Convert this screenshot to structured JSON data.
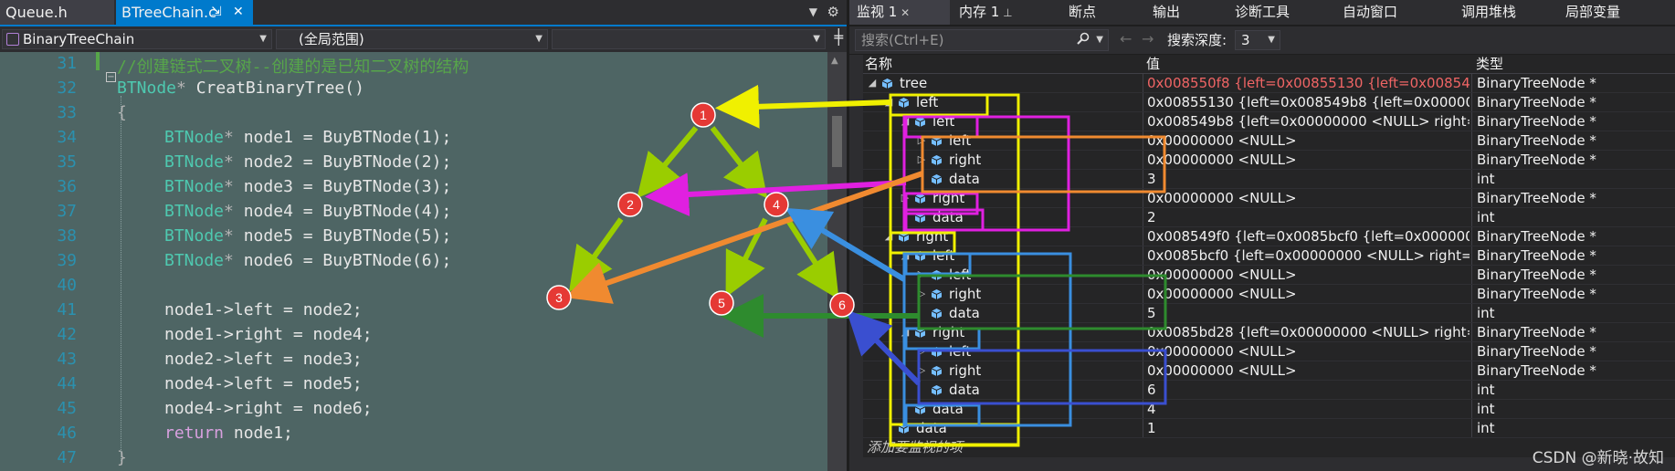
{
  "editor": {
    "tabs": [
      {
        "label": "Queue.h"
      },
      {
        "label": "BTreeChain.c"
      }
    ],
    "nav": {
      "file_scope": "BinaryTreeChain",
      "global_scope": "(全局范围)",
      "member": ""
    },
    "lines": [
      {
        "n": "31",
        "tokens": [
          {
            "c": "comment",
            "t": "//创建链式二叉树--创建的是已知二叉树的结构"
          }
        ]
      },
      {
        "n": "32",
        "tokens": [
          {
            "c": "type",
            "t": "BTNode"
          },
          {
            "c": "punct",
            "t": "* "
          },
          {
            "c": "plain",
            "t": "CreatBinaryTree()"
          }
        ]
      },
      {
        "n": "33",
        "tokens": [
          {
            "c": "punct",
            "t": "{"
          }
        ]
      },
      {
        "n": "34",
        "tokens": [
          {
            "c": "type",
            "t": "BTNode"
          },
          {
            "c": "punct",
            "t": "* "
          },
          {
            "c": "plain",
            "t": "node1 = BuyBTNode(1);"
          }
        ]
      },
      {
        "n": "35",
        "tokens": [
          {
            "c": "type",
            "t": "BTNode"
          },
          {
            "c": "punct",
            "t": "* "
          },
          {
            "c": "plain",
            "t": "node2 = BuyBTNode(2);"
          }
        ]
      },
      {
        "n": "36",
        "tokens": [
          {
            "c": "type",
            "t": "BTNode"
          },
          {
            "c": "punct",
            "t": "* "
          },
          {
            "c": "plain",
            "t": "node3 = BuyBTNode(3);"
          }
        ]
      },
      {
        "n": "37",
        "tokens": [
          {
            "c": "type",
            "t": "BTNode"
          },
          {
            "c": "punct",
            "t": "* "
          },
          {
            "c": "plain",
            "t": "node4 = BuyBTNode(4);"
          }
        ]
      },
      {
        "n": "38",
        "tokens": [
          {
            "c": "type",
            "t": "BTNode"
          },
          {
            "c": "punct",
            "t": "* "
          },
          {
            "c": "plain",
            "t": "node5 = BuyBTNode(5);"
          }
        ]
      },
      {
        "n": "39",
        "tokens": [
          {
            "c": "type",
            "t": "BTNode"
          },
          {
            "c": "punct",
            "t": "* "
          },
          {
            "c": "plain",
            "t": "node6 = BuyBTNode(6);"
          }
        ]
      },
      {
        "n": "40",
        "tokens": []
      },
      {
        "n": "41",
        "tokens": [
          {
            "c": "plain",
            "t": "node1->left = node2;"
          }
        ]
      },
      {
        "n": "42",
        "tokens": [
          {
            "c": "plain",
            "t": "node1->right = node4;"
          }
        ]
      },
      {
        "n": "43",
        "tokens": [
          {
            "c": "plain",
            "t": "node2->left = node3;"
          }
        ]
      },
      {
        "n": "44",
        "tokens": [
          {
            "c": "plain",
            "t": "node4->left = node5;"
          }
        ]
      },
      {
        "n": "45",
        "tokens": [
          {
            "c": "plain",
            "t": "node4->right = node6;"
          }
        ]
      },
      {
        "n": "46",
        "tokens": [
          {
            "c": "kw",
            "t": "return "
          },
          {
            "c": "plain",
            "t": "node1;"
          }
        ]
      },
      {
        "n": "47",
        "tokens": [
          {
            "c": "punct",
            "t": "}"
          }
        ]
      }
    ]
  },
  "tree_nodes": [
    "1",
    "2",
    "3",
    "4",
    "5",
    "6"
  ],
  "watch": {
    "tabs": [
      "监视 1",
      "内存 1",
      "断点",
      "输出",
      "诊断工具",
      "自动窗口",
      "调用堆栈",
      "局部变量"
    ],
    "search_placeholder": "搜索(Ctrl+E)",
    "depth_label": "搜索深度:",
    "depth_value": "3",
    "columns": [
      "名称",
      "值",
      "类型"
    ],
    "rows": [
      {
        "name": "tree",
        "value": "0x008550f8 {left=0x00855130 {left=0x008549b8 {left=0x0000...",
        "type": "BinaryTreeNode *",
        "depth": 0,
        "exp": "open",
        "changed": true
      },
      {
        "name": "left",
        "value": "0x00855130 {left=0x008549b8 {left=0x00000000 <NULL> rig...",
        "type": "BinaryTreeNode *",
        "depth": 1,
        "exp": "open"
      },
      {
        "name": "left",
        "value": "0x008549b8 {left=0x00000000 <NULL> right=0x00000000 <N...",
        "type": "BinaryTreeNode *",
        "depth": 2,
        "exp": "open"
      },
      {
        "name": "left",
        "value": "0x00000000 <NULL>",
        "type": "BinaryTreeNode *",
        "depth": 3,
        "exp": "closed"
      },
      {
        "name": "right",
        "value": "0x00000000 <NULL>",
        "type": "BinaryTreeNode *",
        "depth": 3,
        "exp": "closed"
      },
      {
        "name": "data",
        "value": "3",
        "type": "int",
        "depth": 3,
        "exp": "none"
      },
      {
        "name": "right",
        "value": "0x00000000 <NULL>",
        "type": "BinaryTreeNode *",
        "depth": 2,
        "exp": "closed"
      },
      {
        "name": "data",
        "value": "2",
        "type": "int",
        "depth": 2,
        "exp": "none"
      },
      {
        "name": "right",
        "value": "0x008549f0 {left=0x0085bcf0 {left=0x00000000 <NULL> right...",
        "type": "BinaryTreeNode *",
        "depth": 1,
        "exp": "open"
      },
      {
        "name": "left",
        "value": "0x0085bcf0 {left=0x00000000 <NULL> right=0x00000000 <N...",
        "type": "BinaryTreeNode *",
        "depth": 2,
        "exp": "open"
      },
      {
        "name": "left",
        "value": "0x00000000 <NULL>",
        "type": "BinaryTreeNode *",
        "depth": 3,
        "exp": "closed"
      },
      {
        "name": "right",
        "value": "0x00000000 <NULL>",
        "type": "BinaryTreeNode *",
        "depth": 3,
        "exp": "closed"
      },
      {
        "name": "data",
        "value": "5",
        "type": "int",
        "depth": 3,
        "exp": "none"
      },
      {
        "name": "right",
        "value": "0x0085bd28 {left=0x00000000 <NULL> right=0x00000000 <...",
        "type": "BinaryTreeNode *",
        "depth": 2,
        "exp": "open"
      },
      {
        "name": "left",
        "value": "0x00000000 <NULL>",
        "type": "BinaryTreeNode *",
        "depth": 3,
        "exp": "closed"
      },
      {
        "name": "right",
        "value": "0x00000000 <NULL>",
        "type": "BinaryTreeNode *",
        "depth": 3,
        "exp": "closed"
      },
      {
        "name": "data",
        "value": "6",
        "type": "int",
        "depth": 3,
        "exp": "none"
      },
      {
        "name": "data",
        "value": "4",
        "type": "int",
        "depth": 2,
        "exp": "none"
      },
      {
        "name": "data",
        "value": "1",
        "type": "int",
        "depth": 1,
        "exp": "none"
      }
    ],
    "add_watch": "添加要监视的项",
    "watermark": "CSDN @新晓·故知"
  },
  "colors": {
    "node_fill": "#e53935",
    "yellow": "#f0f000",
    "magenta": "#e020e0",
    "orange": "#f08a30",
    "blue": "#3a8fe0",
    "green": "#2e8b2e",
    "navy": "#3a4fd0",
    "lime": "#9acd00"
  }
}
